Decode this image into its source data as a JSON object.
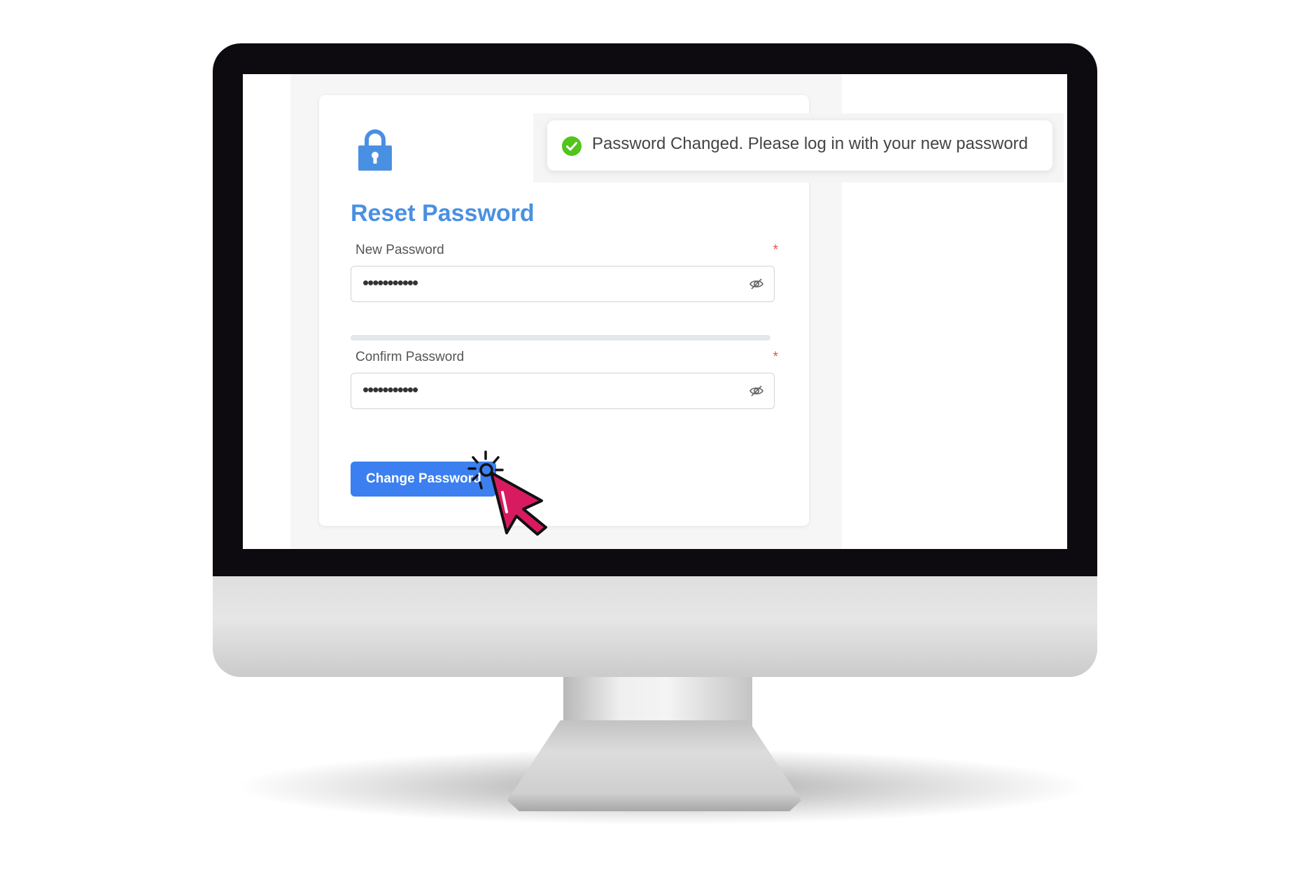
{
  "reset_form": {
    "title": "Reset Password",
    "new_password": {
      "label": "New Password",
      "required_mark": "*",
      "value": "•••••••••••"
    },
    "confirm_password": {
      "label": "Confirm Password",
      "required_mark": "*",
      "value": "•••••••••••"
    },
    "submit_label": "Change Password"
  },
  "toast": {
    "message": "Password Changed. Please log in with your new password",
    "status": "success"
  },
  "icons": {
    "lock": "lock-icon",
    "eye": "eye-slash-icon",
    "success": "check-circle-icon",
    "cursor": "pointer-cursor-icon"
  },
  "colors": {
    "accent": "#4a90e2",
    "button": "#3b7ff0",
    "required": "#e05555",
    "success": "#52c41a",
    "cursor": "#d81b60"
  }
}
